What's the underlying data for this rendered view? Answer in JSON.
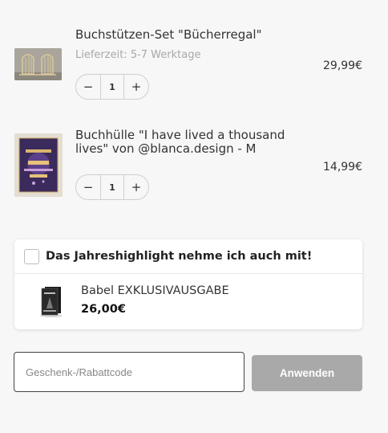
{
  "cart": {
    "items": [
      {
        "title": "Buchstützen-Set \"Bücherregal\"",
        "meta": "Lieferzeit: 5-7 Werktage",
        "price": "29,99€",
        "quantity": "1",
        "image_icon": "bookends-thumbnail"
      },
      {
        "title": "Buchhülle \"I have lived a thousand lives\" von @blanca.design - M",
        "meta": "",
        "price": "14,99€",
        "quantity": "1",
        "image_icon": "book-sleeve-thumbnail"
      }
    ],
    "stepper": {
      "minus": "−",
      "plus": "+"
    }
  },
  "upsell": {
    "label": "Das Jahreshighlight nehme ich auch mit!",
    "checked": false,
    "product_name": "Babel EXKLUSIVAUSGABE",
    "product_price": "26,00€",
    "image_icon": "book-cover-thumbnail"
  },
  "coupon": {
    "placeholder": "Geschenk-/Rabattcode",
    "value": "",
    "apply_label": "Anwenden"
  },
  "colors": {
    "background": "#f7f7f7",
    "apply_button": "#a9a9a9",
    "muted_text": "#a8a8a8"
  }
}
